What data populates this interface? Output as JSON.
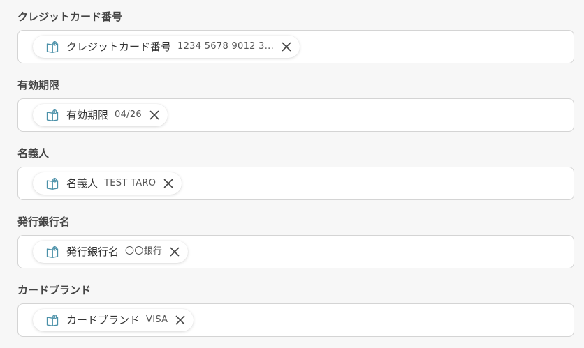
{
  "fields": [
    {
      "label": "クレジットカード番号",
      "chip": {
        "name": "クレジットカード番号",
        "value": "1234 5678 9012 3...",
        "icon": "book-icon",
        "close_icon": "close-icon"
      }
    },
    {
      "label": "有効期限",
      "chip": {
        "name": "有効期限",
        "value": "04/26",
        "icon": "book-icon",
        "close_icon": "close-icon"
      }
    },
    {
      "label": "名義人",
      "chip": {
        "name": "名義人",
        "value": "TEST TARO",
        "icon": "book-icon",
        "close_icon": "close-icon"
      }
    },
    {
      "label": "発行銀行名",
      "chip": {
        "name": "発行銀行名",
        "value": "〇〇銀行",
        "icon": "book-icon",
        "close_icon": "close-icon"
      }
    },
    {
      "label": "カードブランド",
      "chip": {
        "name": "カードブランド",
        "value": "VISA",
        "icon": "book-icon",
        "close_icon": "close-icon"
      }
    }
  ],
  "colors": {
    "icon_accent": "#4a90a8",
    "label_text": "#444444",
    "border": "#d4d4d4",
    "background": "#f7f7f7"
  }
}
